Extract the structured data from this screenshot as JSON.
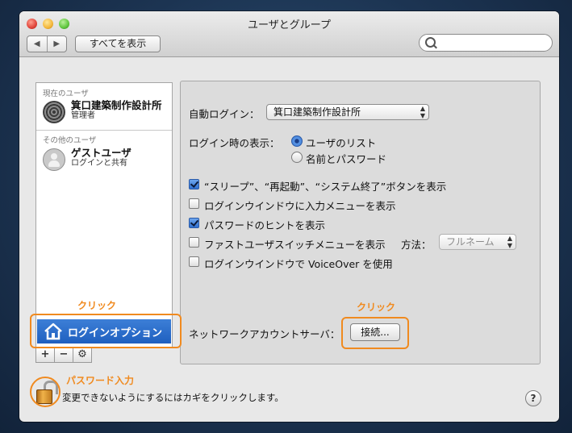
{
  "window": {
    "title": "ユーザとグループ",
    "back_label": "◀",
    "forward_label": "▶",
    "show_all_label": "すべてを表示",
    "search_placeholder": ""
  },
  "sidebar": {
    "current_header": "現在のユーザ",
    "current_user": {
      "name": "箕口建築制作設計所",
      "role": "管理者"
    },
    "other_header": "その他のユーザ",
    "guest_user": {
      "name": "ゲストユーザ",
      "sub": "ログインと共有"
    },
    "login_options_label": "ログインオプション",
    "add_label": "+",
    "remove_label": "−",
    "action_label": "⚙"
  },
  "panel": {
    "auto_login_label": "自動ログイン：",
    "auto_login_value": "箕口建築制作設計所",
    "display_label": "ログイン時の表示：",
    "radio_list_label": "ユーザのリスト",
    "radio_list_checked": true,
    "radio_name_label": "名前とパスワード",
    "radio_name_checked": false,
    "checkboxes": [
      {
        "label": "“スリープ”、“再起動”、“システム終了”ボタンを表示",
        "checked": true
      },
      {
        "label": "ログインウインドウに入力メニューを表示",
        "checked": false
      },
      {
        "label": "パスワードのヒントを表示",
        "checked": true
      },
      {
        "label": "ファストユーザスイッチメニューを表示",
        "checked": false
      },
      {
        "label": "ログインウインドウで VoiceOver を使用",
        "checked": false
      }
    ],
    "method_label": "方法：",
    "method_value": "フルネーム",
    "network_server_label": "ネットワークアカウントサーバ：",
    "connect_label": "接続..."
  },
  "annotations": {
    "click_left": "クリック",
    "click_right": "クリック",
    "password": "パスワード入力",
    "accent": "#f08a1f"
  },
  "footer": {
    "lock_text": "変更できないようにするにはカギをクリックします。",
    "help_label": "?"
  }
}
